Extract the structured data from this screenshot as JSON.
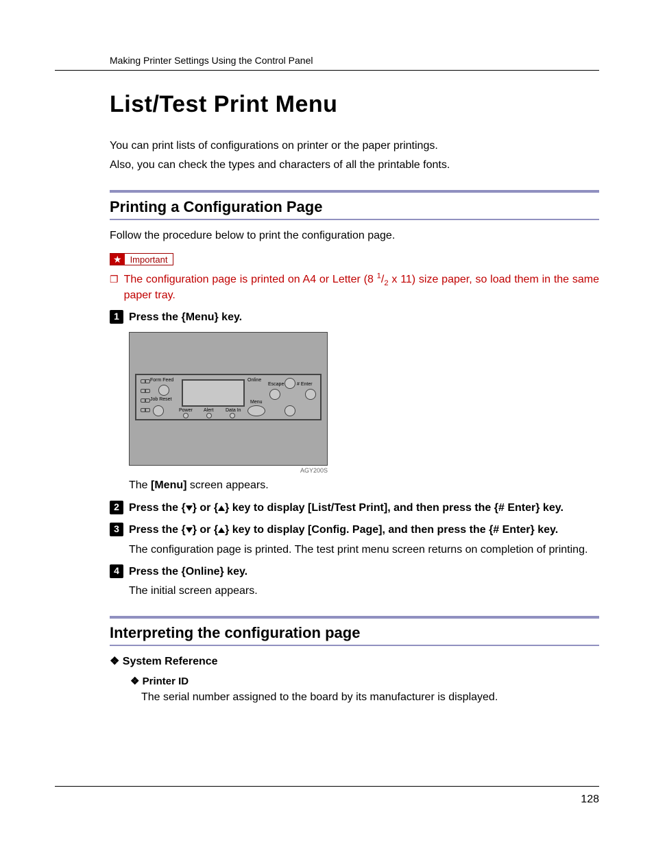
{
  "header": {
    "running_head": "Making Printer Settings Using the Control Panel"
  },
  "title": "List/Test Print Menu",
  "intro": {
    "line1": "You can print lists of configurations on printer or the paper printings.",
    "line2": "Also, you can check the types and characters of all the printable fonts."
  },
  "section1": {
    "heading": "Printing a Configuration Page",
    "lead": "Follow the procedure below to print the configuration page.",
    "important_label": "Important",
    "important_note_prefix": "The configuration page is printed on A4 or Letter (8 ",
    "important_note_frac_num": "1",
    "important_note_frac_den": "2",
    "important_note_suffix": " x 11) size paper, so load them in the same paper tray.",
    "steps": [
      {
        "num": "1",
        "head_prefix": "Press the ",
        "head_key": "{Menu}",
        "head_suffix": " key.",
        "body_prefix": "The ",
        "body_bold": "[Menu]",
        "body_suffix": " screen appears."
      },
      {
        "num": "2",
        "head_p1": "Press the ",
        "head_p2": " or ",
        "head_p3": " key to display ",
        "head_bold1": "[List/Test Print]",
        "head_p4": ", and then press the ",
        "head_key2": "{# Enter}",
        "head_p5": " key."
      },
      {
        "num": "3",
        "head_p1": "Press the ",
        "head_p2": " or ",
        "head_p3": " key to display ",
        "head_bold1": "[Config. Page]",
        "head_p4": ", and then press the ",
        "head_key2": "{# Enter}",
        "head_p5": " key.",
        "body": "The configuration page is printed. The test print menu screen returns on completion of printing."
      },
      {
        "num": "4",
        "head_prefix": "Press the ",
        "head_key": "{Online}",
        "head_suffix": " key.",
        "body": "The initial screen appears."
      }
    ]
  },
  "panel": {
    "form_feed": "Form Feed",
    "job_reset": "Job Reset",
    "power": "Power",
    "alert": "Alert",
    "data_in": "Data In",
    "online": "Online",
    "menu": "Menu",
    "escape": "Escape",
    "enter": "# Enter",
    "figure_id": "AGY200S"
  },
  "section2": {
    "heading": "Interpreting the configuration page",
    "item1": {
      "head": "System Reference"
    },
    "item2": {
      "head": "Printer ID",
      "body": "The serial number assigned to the board by its manufacturer is displayed."
    }
  },
  "page_number": "128"
}
